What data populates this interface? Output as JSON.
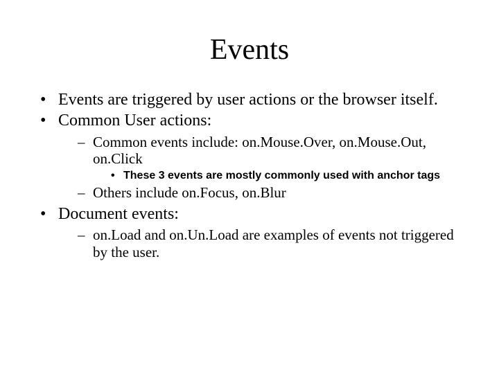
{
  "title": "Events",
  "b1": "Events are triggered by user actions or the browser itself.",
  "b2": "Common User actions:",
  "b2a": "Common events include: on.Mouse.Over, on.Mouse.Out, on.Click",
  "b2a1": "These 3 events are mostly commonly used with anchor tags",
  "b2b": "Others include on.Focus, on.Blur",
  "b3": "Document events:",
  "b3a": "on.Load and on.Un.Load are examples of events not triggered by the user."
}
